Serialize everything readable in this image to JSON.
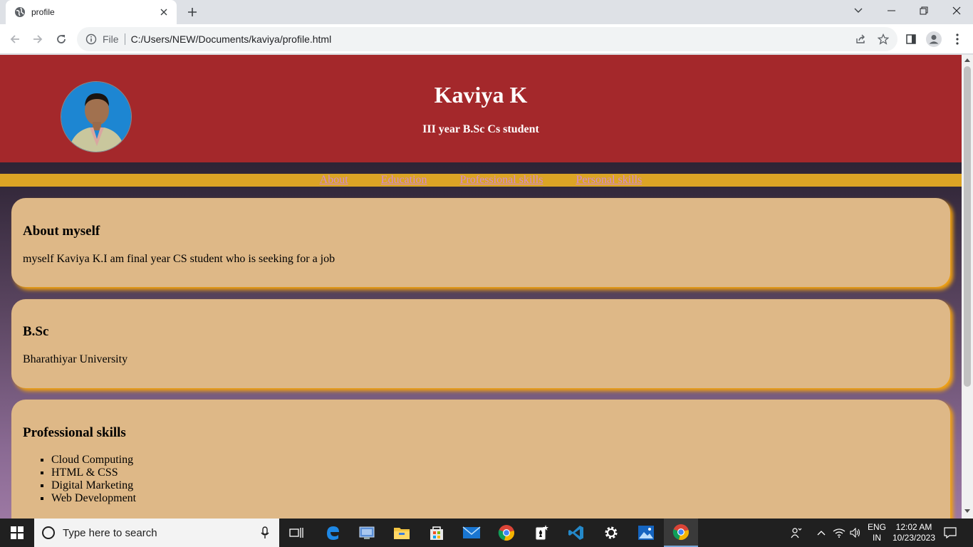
{
  "browser": {
    "tab_title": "profile",
    "omnibox_scheme": "File",
    "url": "C:/Users/NEW/Documents/kaviya/profile.html"
  },
  "page": {
    "name": "Kaviya K",
    "subtitle": "III year B.Sc Cs student",
    "nav": [
      "About",
      "Education",
      "Professional skills",
      "Personal skills"
    ],
    "about": {
      "heading": "About myself",
      "text": "myself Kaviya K.I am final year CS student who is seeking for a job"
    },
    "education": {
      "heading": "B.Sc",
      "text": "Bharathiyar University"
    },
    "professional": {
      "heading": "Professional skills",
      "items": [
        "Cloud Computing",
        "HTML & CSS",
        "Digital Marketing",
        "Web Development"
      ]
    }
  },
  "taskbar": {
    "search_placeholder": "Type here to search",
    "lang_top": "ENG",
    "lang_bottom": "IN",
    "time": "12:02 AM",
    "date": "10/23/2023"
  },
  "colors": {
    "hero": "#a4282b",
    "nav": "#dca425",
    "card": "#deb887",
    "card_shadow": "#f5a40f"
  }
}
